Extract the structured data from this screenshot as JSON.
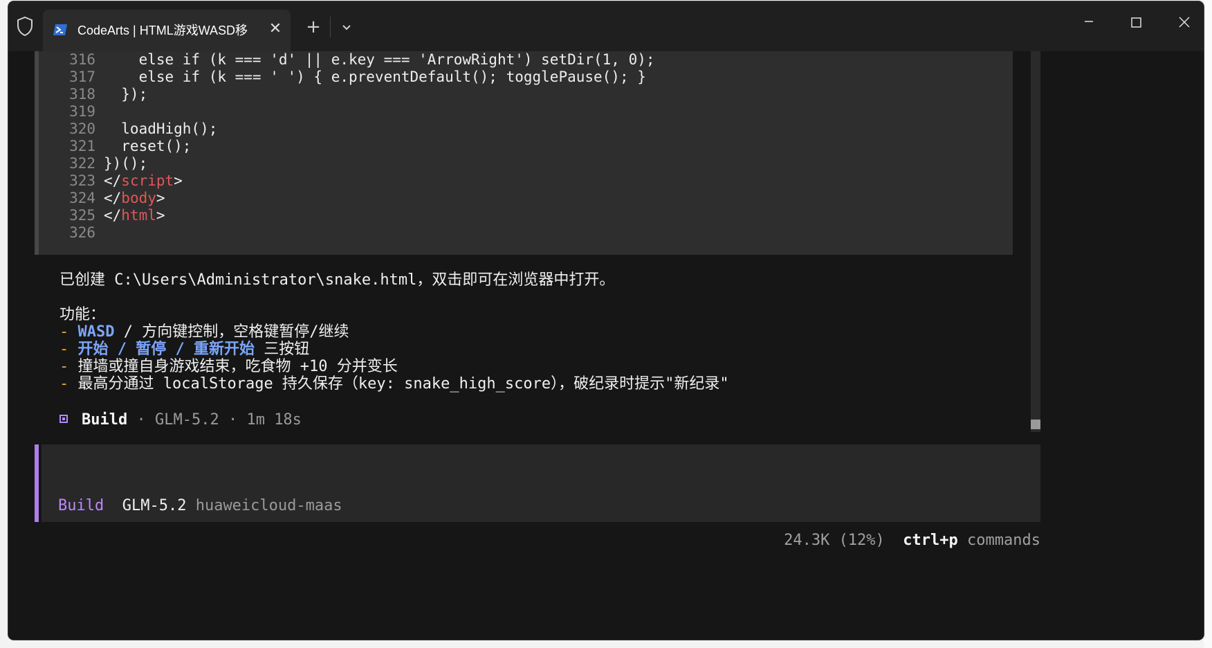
{
  "window": {
    "tab_title": "CodeArts | HTML游戏WASD移",
    "tab_close": "✕",
    "new_tab": "+"
  },
  "code": {
    "lines": [
      {
        "num": "316",
        "text": "    else if (k === 'd' || e.key === 'ArrowRight') setDir(1, 0);"
      },
      {
        "num": "317",
        "text": "    else if (k === ' ') { e.preventDefault(); togglePause(); }"
      },
      {
        "num": "318",
        "text": "  });"
      },
      {
        "num": "319",
        "text": ""
      },
      {
        "num": "320",
        "text": "  loadHigh();"
      },
      {
        "num": "321",
        "text": "  reset();"
      },
      {
        "num": "322",
        "text": "})();"
      },
      {
        "num": "323",
        "pre": "</",
        "tag": "script",
        "post": ">"
      },
      {
        "num": "324",
        "pre": "</",
        "tag": "body",
        "post": ">"
      },
      {
        "num": "325",
        "pre": "</",
        "tag": "html",
        "post": ">"
      },
      {
        "num": "326",
        "text": ""
      }
    ]
  },
  "message": {
    "created": "已创建 C:\\Users\\Administrator\\snake.html，双击即可在浏览器中打开。",
    "features_heading": "功能：",
    "bullet": "-",
    "f1_hl": "WASD",
    "f1_rest": " / 方向键控制，空格键暂停/继续",
    "f2_hl": "开始 / 暂停 / 重新开始",
    "f2_rest": " 三按钮",
    "f3": "撞墙或撞自身游戏结束，吃食物 +10 分并变长",
    "f4": "最高分通过 localStorage 持久保存（key: snake_high_score），破纪录时提示\"新纪录\""
  },
  "build_info": {
    "label": "Build",
    "sep1": " · ",
    "model": "GLM-5.2",
    "sep2": " · ",
    "duration": "1m 18s"
  },
  "prompt": {
    "agent": "Build",
    "model": "GLM-5.2",
    "provider": "huaweicloud-maas"
  },
  "status": {
    "context": "24.3K (12%)",
    "shortcut": "ctrl+p",
    "shortcut_label": "commands"
  },
  "colors": {
    "accent_purple": "#b07ee8",
    "bullet_orange": "#f5a623",
    "highlight_blue": "#7aa6ff",
    "tag_red": "#e0575a"
  }
}
